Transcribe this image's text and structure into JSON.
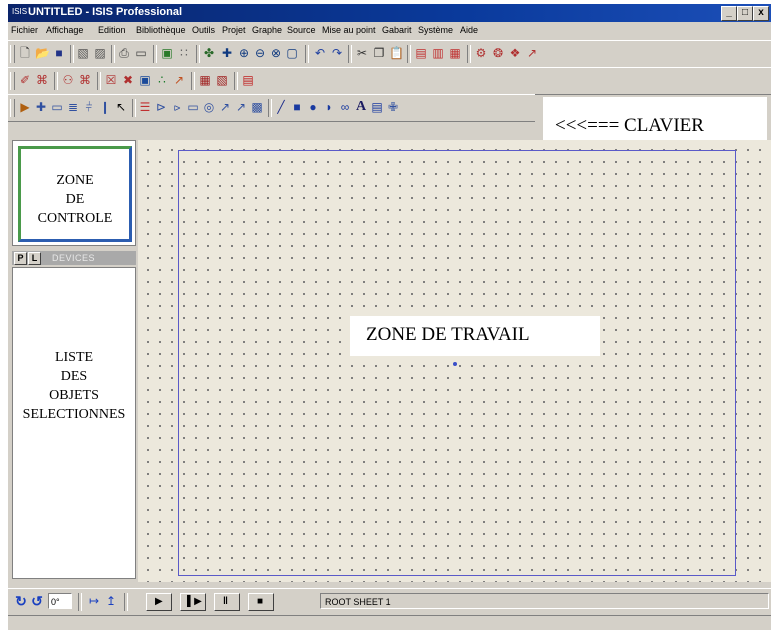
{
  "window": {
    "app_icon": "ISIS",
    "title": "UNTITLED - ISIS Professional",
    "controls": [
      "_",
      "□",
      "x"
    ]
  },
  "menu": [
    "Fichier",
    "Affichage",
    "Edition",
    "Bibliothèque",
    "Outils",
    "Projet",
    "Graphe",
    "Source",
    "Mise au point",
    "Gabarit",
    "Système",
    "Aide"
  ],
  "colors": {
    "titlebar": "#0a246a",
    "chrome": "#d4d0c8",
    "workspace": "#ece8dc",
    "sheet_border": "#5a5ac8",
    "zone_controle_border": "#4a9a4a"
  },
  "toolbar1_icons": [
    "new-icon",
    "open-icon",
    "save-icon",
    "import-icon",
    "export-icon",
    "print-icon",
    "print-area-icon",
    "refresh-icon",
    "grid-icon",
    "origin-icon",
    "pan-icon",
    "zoom-in-icon",
    "zoom-out-icon",
    "zoom-all-icon",
    "zoom-area-icon",
    "undo-icon",
    "redo-icon",
    "cut-icon",
    "copy-icon",
    "paste-icon",
    "block-copy-icon",
    "block-move-icon",
    "block-delete-icon",
    "pick-device-icon",
    "make-device-icon",
    "package-icon",
    "decompose-icon"
  ],
  "toolbar2_icons": [
    "autorouter-icon",
    "search-tag-icon",
    "property-icon",
    "new-sheet-icon",
    "delete-sheet-icon",
    "goto-sheet-icon",
    "bom-icon",
    "netlist-icon",
    "erc-icon",
    "pcb-icon"
  ],
  "toolbar3_icons": [
    "component-icon",
    "junction-icon",
    "wire-label-icon",
    "script-icon",
    "bus-icon",
    "subcircuit-icon",
    "select-icon",
    "terminal-icon",
    "pin-icon",
    "graph-icon",
    "tape-icon",
    "generator-icon",
    "probe-voltage-icon",
    "probe-current-icon",
    "instrument-icon",
    "line-icon",
    "box-icon",
    "circle-icon",
    "arc-icon",
    "path-icon",
    "text-icon",
    "symbol-icon",
    "marker-icon"
  ],
  "keyboard_label": "<<<===  CLAVIER",
  "left_panel": {
    "zone_controle": [
      "ZONE",
      "DE",
      "CONTROLE"
    ],
    "tab_p": "P",
    "tab_l": "L",
    "devices_label": "DEVICES",
    "liste": [
      "LISTE",
      "DES",
      "OBJETS",
      "SELECTIONNES"
    ]
  },
  "workspace": {
    "label": "ZONE DE TRAVAIL"
  },
  "status": {
    "rotation_value": "0°",
    "sheet_name": "ROOT SHEET 1"
  }
}
